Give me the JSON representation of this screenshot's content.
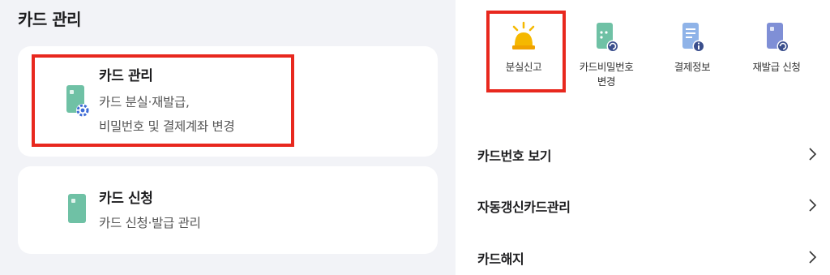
{
  "left": {
    "section_title": "카드 관리",
    "cards": [
      {
        "title": "카드 관리",
        "desc_line1": "카드 분실·재발급,",
        "desc_line2": "비밀번호 및 결제계좌 변경",
        "icon": "card-gear-icon"
      },
      {
        "title": "카드 신청",
        "desc_line1": "카드 신청·발급 관리",
        "icon": "card-icon"
      }
    ]
  },
  "right": {
    "quick_actions": [
      {
        "label": "분실신고",
        "icon": "alarm-siren-icon"
      },
      {
        "label_line1": "카드비밀번호",
        "label_line2": "변경",
        "icon": "card-password-change-icon"
      },
      {
        "label": "결제정보",
        "icon": "document-info-icon"
      },
      {
        "label": "재발급 신청",
        "icon": "card-reissue-icon"
      }
    ],
    "menu": [
      {
        "label": "카드번호 보기"
      },
      {
        "label": "자동갱신카드관리"
      },
      {
        "label": "카드해지"
      }
    ]
  },
  "colors": {
    "highlight": "#e8281e",
    "card_teal": "#6fc1a5",
    "gear_blue": "#3d6bd6",
    "siren_yellow": "#f5b800",
    "doc_blue": "#8fb3e8",
    "card_purple": "#7f8fd6"
  }
}
